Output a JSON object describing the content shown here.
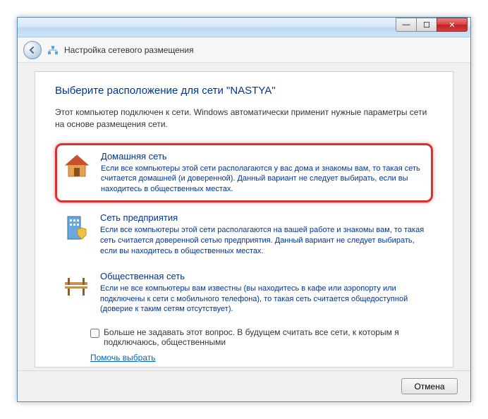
{
  "titlebar": {
    "minimize": "—",
    "maximize": "☐",
    "close": "✕"
  },
  "header": {
    "title": "Настройка сетевого размещения"
  },
  "main": {
    "heading": "Выберите расположение для сети \"NASTYA\"",
    "description": "Этот компьютер подключен к сети. Windows автоматически применит нужные параметры сети на основе размещения сети."
  },
  "options": [
    {
      "title": "Домашняя сеть",
      "desc": "Если все компьютеры этой сети располагаются у вас дома и знакомы вам, то такая сеть считается домашней (и доверенной). Данный вариант не следует выбирать, если вы находитесь в общественных местах."
    },
    {
      "title": "Сеть предприятия",
      "desc": "Если все компьютеры этой сети располагаются на вашей работе и знакомы вам, то такая сеть считается доверенной сетью предприятия. Данный вариант не следует выбирать, если вы находитесь в общественных местах."
    },
    {
      "title": "Общественная сеть",
      "desc": "Если не все компьютеры вам известны (вы находитесь в кафе или аэропорту или подключены к сети с мобильного телефона), то такая сеть считается общедоступной (доверие к таким сетям отсутствует)."
    }
  ],
  "checkbox": {
    "label": "Больше не задавать этот вопрос. В будущем считать все сети, к которым я подключаюсь, общественными"
  },
  "help_link": "Помочь выбрать",
  "footer": {
    "cancel": "Отмена"
  }
}
